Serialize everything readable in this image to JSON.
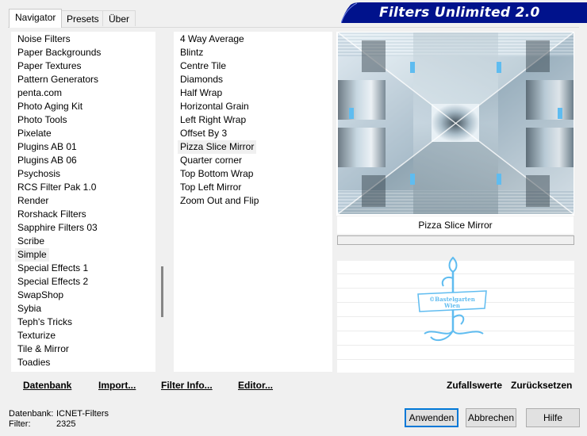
{
  "tabs": [
    {
      "label": "Navigator"
    },
    {
      "label": "Presets"
    },
    {
      "label": "Über"
    }
  ],
  "banner": {
    "title": "Filters Unlimited 2.0"
  },
  "categories": {
    "items": [
      "Noise Filters",
      "Paper Backgrounds",
      "Paper Textures",
      "Pattern Generators",
      "penta.com",
      "Photo Aging Kit",
      "Photo Tools",
      "Pixelate",
      "Plugins AB 01",
      "Plugins AB 06",
      "Psychosis",
      "RCS Filter Pak 1.0",
      "Render",
      "Rorshack Filters",
      "Sapphire Filters 03",
      "Scribe",
      "Simple",
      "Special Effects 1",
      "Special Effects 2",
      "SwapShop",
      "Sybia",
      "Teph's Tricks",
      "Texturize",
      "Tile & Mirror",
      "Toadies"
    ],
    "selected": "Simple"
  },
  "filters": {
    "items": [
      "4 Way Average",
      "Blintz",
      "Centre Tile",
      "Diamonds",
      "Half Wrap",
      "Horizontal Grain",
      "Left Right Wrap",
      "Offset By 3",
      "Pizza Slice Mirror",
      "Quarter corner",
      "Top Bottom Wrap",
      "Top Left Mirror",
      "Zoom Out and Flip"
    ],
    "selected": "Pizza Slice Mirror"
  },
  "preview": {
    "filter_name": "Pizza Slice Mirror"
  },
  "watermark": {
    "line1": "©Bastelgarten",
    "line2": "Wien"
  },
  "toolbar": {
    "datenbank": "Datenbank",
    "import": "Import...",
    "filter_info": "Filter Info...",
    "editor": "Editor...",
    "zufallswerte": "Zufallswerte",
    "zuruecksetzen": "Zurücksetzen"
  },
  "status": {
    "database_label": "Datenbank:",
    "database_value": "ICNET-Filters",
    "filter_label": "Filter:",
    "filter_value": "2325"
  },
  "buttons": {
    "apply": "Anwenden",
    "cancel": "Abbrechen",
    "help": "Hilfe"
  },
  "colors": {
    "banner_bg": "#00128c",
    "accent": "#0078d7",
    "preview_blue": "#5fbcf0"
  }
}
